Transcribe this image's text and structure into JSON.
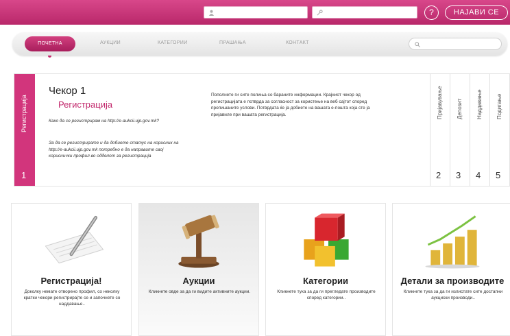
{
  "header": {
    "username_icon": "user-icon",
    "password_icon": "key-icon",
    "help_label": "?",
    "login_label": "НАЈАВИ СЕ"
  },
  "nav": {
    "items": [
      "ПОЧЕТНА",
      "АУКЦИИ",
      "КАТЕГОРИИ",
      "ПРАШАЊА",
      "КОНТАКТ"
    ],
    "search_icon": "search-icon"
  },
  "step": {
    "side_label": "Регистрација",
    "side_number": "1",
    "title": "Чекор 1",
    "subtitle": "Регистрација",
    "question": "Како да се регистрирам на http://e-aukcii.ujp.gov.mk?",
    "answer": "За да се регистрирате и да добиете статус на корисник на http://e-aukcii.ujp.gov.mk потребно е да направите свој кориснички профил во одделот за регистрација",
    "body": "Пополнете ги сите полиња со бараните информации. Крајниот чекор од регистрацијата е потврда за согласност за користење на веб сајтот според пропишаните услови. Потврдата ќе ја добиете на вашата е-пошта која сте ја пријавиле при вашата регистрација.",
    "columns": [
      {
        "label": "Пријавување",
        "number": "2"
      },
      {
        "label": "Депозит",
        "number": "3"
      },
      {
        "label": "Наддавање",
        "number": "4"
      },
      {
        "label": "Подигање",
        "number": "5"
      }
    ]
  },
  "cards": [
    {
      "title": "Регистрација!",
      "text": "Доколку немате отворено профил, со неколку кратки чекори регистрирајте се и започнете со наддавање..",
      "icon": "pen-paper-icon"
    },
    {
      "title": "Аукции",
      "text": "Кликнете овде за да ги видите активните аукции.",
      "icon": "gavel-icon"
    },
    {
      "title": "Категории",
      "text": "Кликнете тука за да ги прегледате производите според категории..",
      "icon": "cubes-icon"
    },
    {
      "title": "Детали за производите",
      "text": "Кликнете тука за да ги излистате сите достапни аукциски производи..",
      "icon": "coins-chart-icon"
    }
  ],
  "colors": {
    "brand": "#c2286c",
    "brand_light": "#d8478a"
  }
}
